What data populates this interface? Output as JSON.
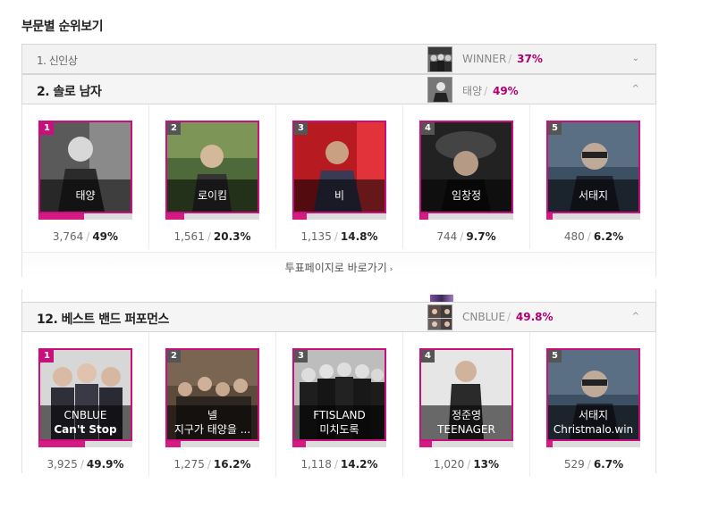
{
  "page_title": "부문별 순위보기",
  "categories": [
    {
      "label": "1. 신인상",
      "winner": "WINNER",
      "winner_pct": "37%",
      "expanded": false
    },
    {
      "label": "2. 솔로 남자",
      "winner": "태양",
      "winner_pct": "49%",
      "expanded": true,
      "nominees": [
        {
          "rank": "1",
          "name": "태양",
          "votes": "3,764",
          "pct": "49%",
          "share": 0.49
        },
        {
          "rank": "2",
          "name": "로이킴",
          "votes": "1,561",
          "pct": "20.3%",
          "share": 0.203
        },
        {
          "rank": "3",
          "name": "비",
          "votes": "1,135",
          "pct": "14.8%",
          "share": 0.148
        },
        {
          "rank": "4",
          "name": "임창정",
          "votes": "744",
          "pct": "9.7%",
          "share": 0.097
        },
        {
          "rank": "5",
          "name": "서태지",
          "votes": "480",
          "pct": "6.2%",
          "share": 0.062
        }
      ],
      "vote_link": "투표페이지로 바로가기"
    },
    {
      "label": "12. 베스트 밴드 퍼포먼스",
      "winner": "CNBLUE",
      "winner_pct": "49.8%",
      "expanded": true,
      "nominees": [
        {
          "rank": "1",
          "name": "CNBLUE",
          "song": "Can't Stop",
          "votes": "3,925",
          "pct": "49.9%",
          "share": 0.499
        },
        {
          "rank": "2",
          "name": "넬",
          "song": "지구가 태양을 ...",
          "votes": "1,275",
          "pct": "16.2%",
          "share": 0.162
        },
        {
          "rank": "3",
          "name": "FTISLAND",
          "song": "미치도록",
          "votes": "1,118",
          "pct": "14.2%",
          "share": 0.142
        },
        {
          "rank": "4",
          "name": "정준영",
          "song": "TEENAGER",
          "votes": "1,020",
          "pct": "13%",
          "share": 0.13
        },
        {
          "rank": "5",
          "name": "서태지",
          "song": "Christmalo.win",
          "votes": "529",
          "pct": "6.7%",
          "share": 0.067
        }
      ]
    }
  ],
  "separator": "/",
  "chevron_down": "⌄",
  "chevron_up": "^",
  "link_arrow": "›",
  "colors": {
    "accent": "#c8107c",
    "bar": "#d61a83",
    "winner_pct": "#b0006f"
  }
}
